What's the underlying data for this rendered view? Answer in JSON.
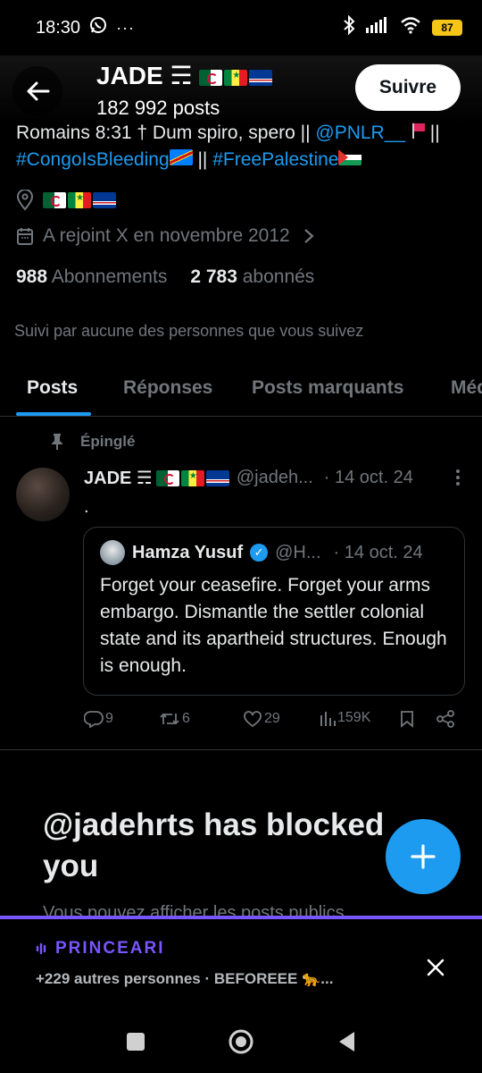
{
  "status_bar": {
    "time": "18:30",
    "icons_left": [
      "whatsapp-icon",
      "more-dots-icon"
    ],
    "icons_right": [
      "bluetooth-icon",
      "signal-icon",
      "wifi-icon",
      "battery-icon"
    ],
    "battery_level": "87",
    "battery_color": "#f5c518"
  },
  "header": {
    "name": "JADE ☴",
    "posts_count": "182 992 posts",
    "follow_label": "Suivre"
  },
  "bio": {
    "line1_text": "Romains 8:31 † Dum spiro, spero || ",
    "line1_mention": "@PNLR__",
    "line1_sep": " ||",
    "hashtag1": "#CongoIsBleeding",
    "sep2": " || ",
    "hashtag2": "#FreePalestine"
  },
  "profile_info": {
    "joined": "A rejoint X en novembre 2012"
  },
  "stats": {
    "following_count": "988",
    "following_label": "Abonnements",
    "followers_count": "2 783",
    "followers_label": "abonnés"
  },
  "followed_by_text": "Suivi par aucune des personnes que vous suivez",
  "tabs": [
    {
      "label": "Posts",
      "active": true
    },
    {
      "label": "Réponses",
      "active": false
    },
    {
      "label": "Posts marquants",
      "active": false
    },
    {
      "label": "Méd",
      "active": false
    }
  ],
  "pinned_tweet": {
    "pinned_label": "Épinglé",
    "author_name": "JADE ☴",
    "handle": "@jadeh...",
    "date": "· 14 oct. 24",
    "text": ".",
    "quote": {
      "author_name": "Hamza Yusuf",
      "handle": "@H...",
      "date": "· 14 oct. 24",
      "text": "Forget your ceasefire. Forget your arms embargo. Dismantle the settler colonial state and its apartheid structures. Enough is enough."
    },
    "actions": {
      "replies": "9",
      "reposts": "6",
      "likes": "29",
      "views": "159K"
    }
  },
  "blocked": {
    "title": "@jadehrts has blocked you",
    "subtitle": "Vous pouvez afficher les posts publics"
  },
  "space_bar": {
    "host": "PRINCEARI",
    "meta": "+229 autres personnes · BEFOREEE 🐆..."
  },
  "colors": {
    "accent": "#1d9bf0",
    "spaces": "#7856ff",
    "muted": "#71767b",
    "text": "#e7e9ea"
  }
}
